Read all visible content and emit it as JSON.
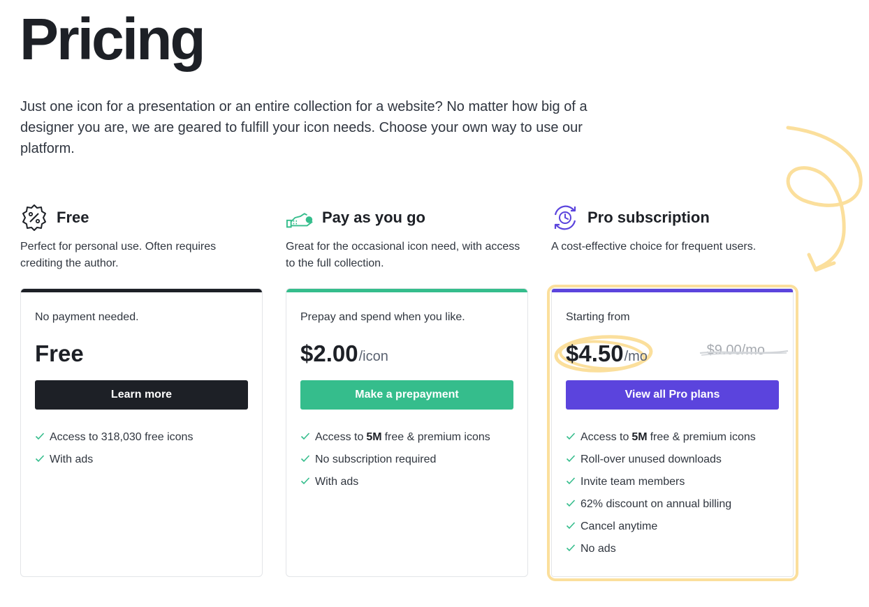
{
  "page": {
    "title": "Pricing",
    "intro": "Just one icon for a presentation or an entire collection for a website? No matter how big of a designer you are, we are geared to fulfill your icon needs. Choose your own way to use our platform."
  },
  "plans": [
    {
      "name": "Free",
      "icon": "percent-badge-icon",
      "description": "Perfect for personal use. Often requires crediting the author.",
      "accent": "#1d2026",
      "pre": "No payment needed.",
      "price": "Free",
      "unit": "",
      "button": "Learn more",
      "button_color": "#1d2026",
      "features": [
        {
          "text": "Access to 318,030 free icons"
        },
        {
          "text": "With ads"
        }
      ]
    },
    {
      "name": "Pay as you go",
      "icon": "hand-coins-icon",
      "description": "Great for the occasional icon need, with access to the full collection.",
      "accent": "#35bd8c",
      "pre": "Prepay and spend when you like.",
      "price": "$2.00",
      "unit": "/icon",
      "button": "Make a prepayment",
      "button_color": "#35bd8c",
      "features": [
        {
          "before": "Access to",
          "bold": "5M",
          "after": "free & premium icons"
        },
        {
          "text": "No subscription required"
        },
        {
          "text": "With ads"
        }
      ]
    },
    {
      "name": "Pro subscription",
      "icon": "clock-refresh-icon",
      "description": "A cost-effective choice for frequent users.",
      "accent": "#5b44dd",
      "pre": "Starting from",
      "price": "$4.50",
      "unit": "/mo",
      "old_price": "$9.00/mo",
      "button": "View all Pro plans",
      "button_color": "#5b44dd",
      "highlight_color": "#fbdf9c",
      "features": [
        {
          "before": "Access to",
          "bold": "5M",
          "after": "free & premium icons"
        },
        {
          "text": "Roll-over unused downloads"
        },
        {
          "text": "Invite team members"
        },
        {
          "text": "62% discount on annual billing"
        },
        {
          "text": "Cancel anytime"
        },
        {
          "text": "No ads"
        }
      ]
    }
  ]
}
